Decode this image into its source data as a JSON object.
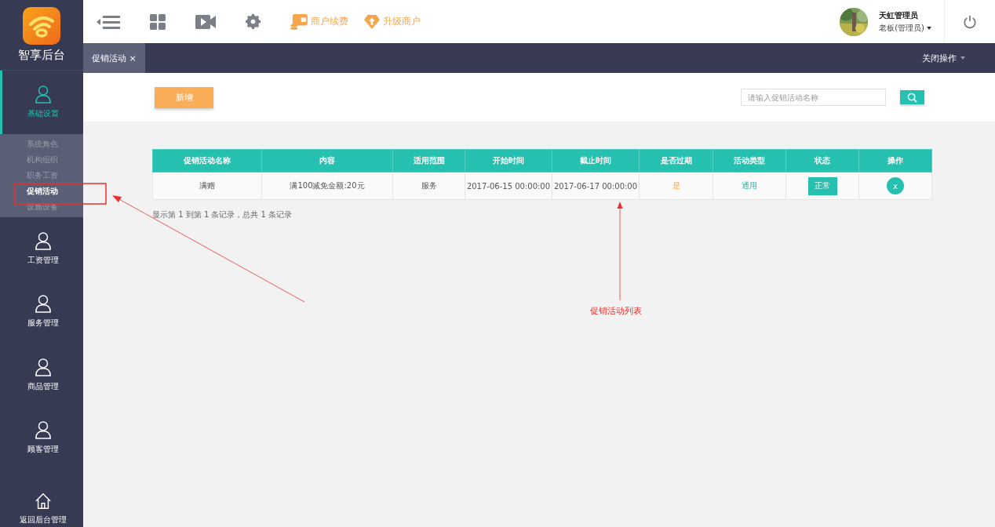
{
  "sidebar": {
    "logo_text": "智享后台",
    "items": [
      {
        "label": "基础设置",
        "kind": "person",
        "selected": true,
        "expanded": true,
        "children": [
          {
            "label": "系统角色",
            "selected": false
          },
          {
            "label": "机构组织",
            "selected": false
          },
          {
            "label": "职务工资",
            "selected": false
          },
          {
            "label": "促销活动",
            "selected": true
          },
          {
            "label": "设施设备",
            "selected": false
          }
        ]
      },
      {
        "label": "工资管理",
        "kind": "person",
        "selected": false
      },
      {
        "label": "服务管理",
        "kind": "person",
        "selected": false
      },
      {
        "label": "商品管理",
        "kind": "person",
        "selected": false
      },
      {
        "label": "顾客管理",
        "kind": "person",
        "selected": false
      },
      {
        "label": "返回后台管理",
        "kind": "home",
        "selected": false
      }
    ]
  },
  "toolbar": {
    "links": [
      {
        "label": "商户续费",
        "kind": "wallet"
      },
      {
        "label": "升级商户",
        "kind": "upgrade"
      }
    ]
  },
  "user": {
    "name": "天虹管理员",
    "role": "老板(管理员)"
  },
  "tabs": [
    {
      "label": "促销活动",
      "close": "×",
      "selected": true
    }
  ],
  "close_menu": "关闭操作",
  "add_button": "新增",
  "search": {
    "placeholder": "请输入促销活动名称"
  },
  "table": {
    "columns": [
      "促销活动名称",
      "内容",
      "适用范围",
      "开始时间",
      "截止时间",
      "是否过期",
      "活动类型",
      "状态",
      "操作"
    ],
    "rows": [
      {
        "cells": [
          {
            "kind": "text",
            "text": "满赠"
          },
          {
            "kind": "text",
            "text": "满100减免金额:20元"
          },
          {
            "kind": "text",
            "text": "服务"
          },
          {
            "kind": "text",
            "text": "2017-06-15 00:00:00"
          },
          {
            "kind": "text",
            "text": "2017-06-17 00:00:00"
          },
          {
            "kind": "expired",
            "text": "是"
          },
          {
            "kind": "type",
            "text": "通用"
          },
          {
            "kind": "status",
            "text": "正常"
          },
          {
            "kind": "action",
            "text": "x"
          }
        ]
      }
    ]
  },
  "footer_info": "显示第 1 到第 1 条记录，总共 1 条记录",
  "annotation": {
    "label": "促销活动列表"
  }
}
